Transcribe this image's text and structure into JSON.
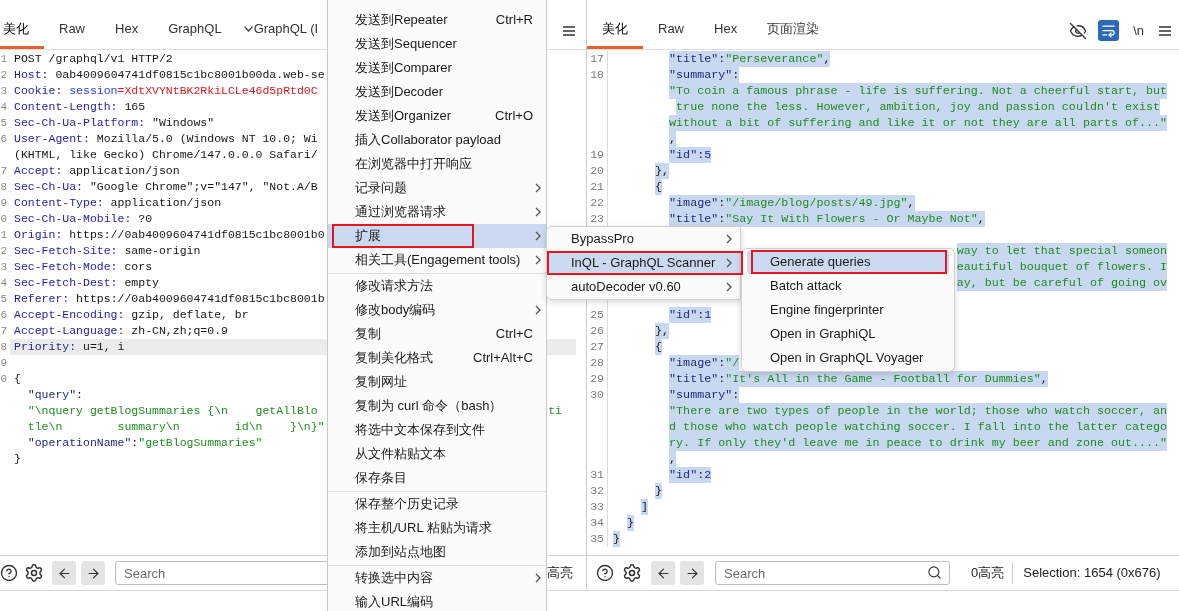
{
  "request_panel": {
    "tabs": [
      {
        "label": "美化",
        "selected": true,
        "kind": "text"
      },
      {
        "label": "Raw",
        "selected": false,
        "kind": "text"
      },
      {
        "label": "Hex",
        "selected": false,
        "kind": "text"
      },
      {
        "label": "GraphQL",
        "selected": false,
        "kind": "text"
      },
      {
        "label": "GraphQL (I",
        "selected": false,
        "kind": "dropdown"
      }
    ],
    "lines": [
      {
        "number": "1",
        "current": false,
        "segments": [
          {
            "text": "POST /graphql/v1 HTTP/2",
            "kind": "plain"
          }
        ]
      },
      {
        "number": "2",
        "current": false,
        "segments": [
          {
            "text": "Host:",
            "kind": "header"
          },
          {
            "text": " 0ab4009604741df0815c1bc8001b00da.web-se",
            "kind": "plain"
          }
        ]
      },
      {
        "number": "3",
        "current": false,
        "segments": [
          {
            "text": "Cookie:",
            "kind": "header"
          },
          {
            "text": " session",
            "kind": "cookie-name"
          },
          {
            "text": "=XdtXVYNtBK2RkiLCLe46d5pRtd0C",
            "kind": "cookie-value"
          }
        ]
      },
      {
        "number": "4",
        "current": false,
        "segments": [
          {
            "text": "Content-Length:",
            "kind": "header"
          },
          {
            "text": " 165",
            "kind": "plain"
          }
        ]
      },
      {
        "number": "5",
        "current": false,
        "segments": [
          {
            "text": "Sec-Ch-Ua-Platform:",
            "kind": "header"
          },
          {
            "text": " \"Windows\"",
            "kind": "plain"
          }
        ]
      },
      {
        "number": "6",
        "current": false,
        "segments": [
          {
            "text": "User-Agent:",
            "kind": "header"
          },
          {
            "text": " Mozilla/5.0 (Windows NT 10.0; Wi",
            "kind": "plain"
          }
        ]
      },
      {
        "current": false,
        "segments": [
          {
            "text": "(KHTML, like Gecko) Chrome/147.0.0.0 Safari/",
            "kind": "plain"
          }
        ]
      },
      {
        "number": "7",
        "current": false,
        "segments": [
          {
            "text": "Accept:",
            "kind": "header"
          },
          {
            "text": " application/json",
            "kind": "plain"
          }
        ]
      },
      {
        "number": "8",
        "current": false,
        "segments": [
          {
            "text": "Sec-Ch-Ua:",
            "kind": "header"
          },
          {
            "text": " \"Google Chrome\";v=\"147\", \"Not.A/B",
            "kind": "plain"
          }
        ]
      },
      {
        "number": "9",
        "current": false,
        "segments": [
          {
            "text": "Content-Type:",
            "kind": "header"
          },
          {
            "text": " application/json",
            "kind": "plain"
          }
        ]
      },
      {
        "number": "0",
        "current": false,
        "segments": [
          {
            "text": "Sec-Ch-Ua-Mobile:",
            "kind": "header"
          },
          {
            "text": " ?0",
            "kind": "plain"
          }
        ]
      },
      {
        "number": "1",
        "current": false,
        "segments": [
          {
            "text": "Origin:",
            "kind": "header"
          },
          {
            "text": " https://0ab4009604741df0815c1bc8001b0",
            "kind": "plain"
          }
        ]
      },
      {
        "number": "2",
        "current": false,
        "segments": [
          {
            "text": "Sec-Fetch-Site:",
            "kind": "header"
          },
          {
            "text": " same-origin",
            "kind": "plain"
          }
        ]
      },
      {
        "number": "3",
        "current": false,
        "segments": [
          {
            "text": "Sec-Fetch-Mode:",
            "kind": "header"
          },
          {
            "text": " cors",
            "kind": "plain"
          }
        ]
      },
      {
        "number": "4",
        "current": false,
        "segments": [
          {
            "text": "Sec-Fetch-Dest:",
            "kind": "header"
          },
          {
            "text": " empty",
            "kind": "plain"
          }
        ]
      },
      {
        "number": "5",
        "current": false,
        "segments": [
          {
            "text": "Referer:",
            "kind": "header"
          },
          {
            "text": " https://0ab4009604741df0815c1bc8001b",
            "kind": "plain"
          }
        ]
      },
      {
        "number": "6",
        "current": false,
        "segments": [
          {
            "text": "Accept-Encoding:",
            "kind": "header"
          },
          {
            "text": " gzip, deflate, br",
            "kind": "plain"
          }
        ]
      },
      {
        "number": "7",
        "current": false,
        "segments": [
          {
            "text": "Accept-Language:",
            "kind": "header"
          },
          {
            "text": " zh-CN,zh;q=0.9",
            "kind": "plain"
          }
        ]
      },
      {
        "number": "8",
        "current": true,
        "segments": [
          {
            "text": "Priority:",
            "kind": "header"
          },
          {
            "text": " u=1, i",
            "kind": "plain"
          }
        ]
      },
      {
        "number": "9",
        "current": false
      },
      {
        "number": "0",
        "current": false,
        "segments": [
          {
            "text": "{",
            "kind": "plain"
          }
        ]
      },
      {
        "current": false,
        "segments": [
          {
            "text": "  \"query\"",
            "kind": "key"
          },
          {
            "text": ":",
            "kind": "punct"
          }
        ]
      },
      {
        "current": false,
        "segments": [
          {
            "text": "  \"\\nquery getBlogSummaries {\\n    getAllBlo",
            "kind": "string"
          }
        ],
        "tail": [
          {
            "text": "ti",
            "kind": "string"
          }
        ]
      },
      {
        "current": false,
        "segments": [
          {
            "text": "  tle\\n        summary\\n        id\\n    }\\n}\"",
            "kind": "string"
          }
        ]
      },
      {
        "current": false,
        "segments": [
          {
            "text": "  \"operationName\"",
            "kind": "key"
          },
          {
            "text": ":",
            "kind": "punct"
          },
          {
            "text": "\"getBlogSummaries\"",
            "kind": "string"
          }
        ]
      },
      {
        "current": false,
        "segments": [
          {
            "text": "}",
            "kind": "plain"
          }
        ]
      }
    ],
    "search": {
      "placeholder": "Search"
    },
    "highlight_count": "高亮"
  },
  "response_panel": {
    "tabs": [
      {
        "label": "美化",
        "selected": true,
        "kind": "text"
      },
      {
        "label": "Raw",
        "selected": false,
        "kind": "text"
      },
      {
        "label": "Hex",
        "selected": false,
        "kind": "text"
      },
      {
        "label": "页面渲染",
        "selected": false,
        "kind": "text"
      }
    ],
    "word_wrap_on": true,
    "newline_toggle": "\\n",
    "lines": [
      {
        "kind": "line",
        "number": "17",
        "selected": true,
        "segments": [
          {
            "text": "        \"title\"",
            "kind": "key"
          },
          {
            "text": ":",
            "kind": "punct"
          },
          {
            "text": "\"Perseverance\"",
            "kind": "string"
          },
          {
            "text": ",",
            "kind": "punct"
          }
        ]
      },
      {
        "kind": "line",
        "number": "18",
        "selected": true,
        "segments": [
          {
            "text": "        \"summary\"",
            "kind": "key"
          },
          {
            "text": ":",
            "kind": "punct"
          }
        ]
      },
      {
        "kind": "line",
        "selected": true,
        "segments": [
          {
            "text": "        \"To coin a famous phrase - life is suffering. Not a cheerful start, but",
            "kind": "string"
          }
        ]
      },
      {
        "kind": "line",
        "selected": true,
        "segments": [
          {
            "text": "         true none the less. However, ambition, joy and passion couldn't exist",
            "kind": "string"
          }
        ]
      },
      {
        "kind": "line",
        "selected": true,
        "segments": [
          {
            "text": "        without a bit of suffering and like it or not they are all parts of...\"",
            "kind": "string"
          }
        ]
      },
      {
        "kind": "line",
        "selected": true,
        "segments": [
          {
            "text": "        ,",
            "kind": "punct"
          }
        ]
      },
      {
        "kind": "line",
        "number": "19",
        "selected": true,
        "segments": [
          {
            "text": "        \"id\"",
            "kind": "key"
          },
          {
            "text": ":",
            "kind": "punct"
          },
          {
            "text": "5",
            "kind": "number"
          }
        ]
      },
      {
        "kind": "line",
        "number": "20",
        "selected": true,
        "segments": [
          {
            "text": "      },",
            "kind": "punct"
          }
        ]
      },
      {
        "kind": "line",
        "number": "21",
        "selected": true,
        "segments": [
          {
            "text": "      {",
            "kind": "punct"
          }
        ]
      },
      {
        "kind": "line",
        "number": "22",
        "selected": true,
        "segments": [
          {
            "text": "        \"image\"",
            "kind": "key"
          },
          {
            "text": ":",
            "kind": "punct"
          },
          {
            "text": "\"/image/blog/posts/49.jpg\"",
            "kind": "string"
          },
          {
            "text": ",",
            "kind": "punct"
          }
        ]
      },
      {
        "kind": "line",
        "number": "23",
        "selected": true,
        "segments": [
          {
            "text": "        \"title\"",
            "kind": "key"
          },
          {
            "text": ":",
            "kind": "punct"
          },
          {
            "text": "\"Say It With Flowers - Or Maybe Not\"",
            "kind": "string"
          },
          {
            "text": ",",
            "kind": "punct"
          }
        ]
      },
      {
        "kind": "covered"
      },
      {
        "kind": "end",
        "selected": true,
        "segments": [
          {
            "text": "way to let that special someon",
            "kind": "string"
          }
        ]
      },
      {
        "kind": "end",
        "selected": true,
        "segments": [
          {
            "text": "eautiful bouquet of flowers. I",
            "kind": "string"
          }
        ]
      },
      {
        "kind": "end",
        "selected": true,
        "segments": [
          {
            "text": "ay, but be careful of going ov",
            "kind": "string"
          }
        ]
      },
      {
        "kind": "covered"
      },
      {
        "kind": "line",
        "number": "25",
        "selected": true,
        "segments": [
          {
            "text": "        \"id\"",
            "kind": "key"
          },
          {
            "text": ":",
            "kind": "punct"
          },
          {
            "text": "1",
            "kind": "number"
          }
        ]
      },
      {
        "kind": "line",
        "number": "26",
        "selected": true,
        "segments": [
          {
            "text": "      },",
            "kind": "punct"
          }
        ]
      },
      {
        "kind": "line",
        "number": "27",
        "selected": true,
        "segments": [
          {
            "text": "      {",
            "kind": "punct"
          }
        ]
      },
      {
        "kind": "line",
        "number": "28",
        "selected": true,
        "segments": [
          {
            "text": "        \"image\"",
            "kind": "key"
          },
          {
            "text": ":",
            "kind": "punct"
          },
          {
            "text": "\"/",
            "kind": "string"
          }
        ]
      },
      {
        "kind": "line",
        "number": "29",
        "selected": true,
        "segments": [
          {
            "text": "        \"title\"",
            "kind": "key"
          },
          {
            "text": ":",
            "kind": "punct"
          },
          {
            "text": "\"It's All in the Game - Football for Dummies\"",
            "kind": "string"
          },
          {
            "text": ",",
            "kind": "punct"
          }
        ]
      },
      {
        "kind": "line",
        "number": "30",
        "selected": true,
        "segments": [
          {
            "text": "        \"summary\"",
            "kind": "key"
          },
          {
            "text": ":",
            "kind": "punct"
          }
        ]
      },
      {
        "kind": "line",
        "selected": true,
        "segments": [
          {
            "text": "        \"There are two types of people in the world; those who watch soccer, an",
            "kind": "string"
          }
        ]
      },
      {
        "kind": "line",
        "selected": true,
        "segments": [
          {
            "text": "        d those who watch people watching soccer. I fall into the latter catego",
            "kind": "string"
          }
        ]
      },
      {
        "kind": "line",
        "selected": true,
        "segments": [
          {
            "text": "        ry. If only they'd leave me in peace to drink my beer and zone out....\"",
            "kind": "string"
          }
        ]
      },
      {
        "kind": "line",
        "selected": true,
        "segments": [
          {
            "text": "        ,",
            "kind": "punct"
          }
        ]
      },
      {
        "kind": "line",
        "number": "31",
        "selected": true,
        "segments": [
          {
            "text": "        \"id\"",
            "kind": "key"
          },
          {
            "text": ":",
            "kind": "punct"
          },
          {
            "text": "2",
            "kind": "number"
          }
        ]
      },
      {
        "kind": "line",
        "number": "32",
        "selected": true,
        "segments": [
          {
            "text": "      }",
            "kind": "punct"
          }
        ]
      },
      {
        "kind": "line",
        "number": "33",
        "selected": true,
        "segments": [
          {
            "text": "    ]",
            "kind": "punct"
          }
        ]
      },
      {
        "kind": "line",
        "number": "34",
        "selected": true,
        "segments": [
          {
            "text": "  }",
            "kind": "punct"
          }
        ]
      },
      {
        "kind": "line",
        "number": "35",
        "selected": true,
        "segments": [
          {
            "text": "}",
            "kind": "punct"
          }
        ]
      }
    ],
    "search": {
      "placeholder": "Search"
    },
    "highlight_count": "0高亮",
    "selection_info": "Selection: 1654 (0x676)"
  },
  "context_menu": {
    "items": [
      {
        "kind": "item",
        "label": "发送到Repeater",
        "shortcut": "Ctrl+R",
        "submenu": false,
        "highlighted": false,
        "annotated": false
      },
      {
        "kind": "item",
        "label": "发送到Sequencer",
        "submenu": false,
        "highlighted": false,
        "annotated": false
      },
      {
        "kind": "item",
        "label": "发送到Comparer",
        "submenu": false,
        "highlighted": false,
        "annotated": false
      },
      {
        "kind": "item",
        "label": "发送到Decoder",
        "submenu": false,
        "highlighted": false,
        "annotated": false
      },
      {
        "kind": "item",
        "label": "发送到Organizer",
        "shortcut": "Ctrl+O",
        "submenu": false,
        "highlighted": false,
        "annotated": false
      },
      {
        "kind": "item",
        "label": "插入Collaborator payload",
        "submenu": false,
        "highlighted": false,
        "annotated": false
      },
      {
        "kind": "item",
        "label": "在浏览器中打开响应",
        "submenu": false,
        "highlighted": false,
        "annotated": false
      },
      {
        "kind": "item",
        "label": "记录问题",
        "submenu": true,
        "highlighted": false,
        "annotated": false
      },
      {
        "kind": "item",
        "label": "通过浏览器请求",
        "submenu": true,
        "highlighted": false,
        "annotated": false
      },
      {
        "kind": "item",
        "label": "扩展",
        "submenu": true,
        "highlighted": true,
        "annotated": true
      },
      {
        "kind": "item",
        "label": "相关工具(Engagement tools)",
        "submenu": true,
        "highlighted": false,
        "annotated": false
      },
      {
        "kind": "separator"
      },
      {
        "kind": "item",
        "label": "修改请求方法",
        "submenu": false,
        "highlighted": false,
        "annotated": false
      },
      {
        "kind": "item",
        "label": "修改body编码",
        "submenu": true,
        "highlighted": false,
        "annotated": false
      },
      {
        "kind": "item",
        "label": "复制",
        "shortcut": "Ctrl+C",
        "submenu": false,
        "highlighted": false,
        "annotated": false
      },
      {
        "kind": "item",
        "label": "复制美化格式",
        "shortcut": "Ctrl+Alt+C",
        "submenu": false,
        "highlighted": false,
        "annotated": false
      },
      {
        "kind": "item",
        "label": "复制网址",
        "submenu": false,
        "highlighted": false,
        "annotated": false
      },
      {
        "kind": "item",
        "label": "复制为 curl 命令（bash）",
        "submenu": false,
        "highlighted": false,
        "annotated": false
      },
      {
        "kind": "item",
        "label": "将选中文本保存到文件",
        "submenu": false,
        "highlighted": false,
        "annotated": false
      },
      {
        "kind": "item",
        "label": "从文件粘贴文本",
        "submenu": false,
        "highlighted": false,
        "annotated": false
      },
      {
        "kind": "item",
        "label": "保存条目",
        "submenu": false,
        "highlighted": false,
        "annotated": false
      },
      {
        "kind": "separator"
      },
      {
        "kind": "item",
        "label": "保存整个历史记录",
        "submenu": false,
        "highlighted": false,
        "annotated": false
      },
      {
        "kind": "item",
        "label": "将主机/URL 粘贴为请求",
        "submenu": false,
        "highlighted": false,
        "annotated": false
      },
      {
        "kind": "item",
        "label": "添加到站点地图",
        "submenu": false,
        "highlighted": false,
        "annotated": false
      },
      {
        "kind": "separator"
      },
      {
        "kind": "item",
        "label": "转换选中内容",
        "submenu": true,
        "highlighted": false,
        "annotated": false
      },
      {
        "kind": "item",
        "label": "输入URL编码",
        "submenu": false,
        "highlighted": false,
        "annotated": false
      }
    ]
  },
  "extensions_submenu": {
    "items": [
      {
        "kind": "item",
        "label": "BypassPro",
        "submenu": true,
        "highlighted": false,
        "annotated": false
      },
      {
        "kind": "item",
        "label": "InQL - GraphQL Scanner",
        "submenu": true,
        "highlighted": true,
        "annotated": true
      },
      {
        "kind": "item",
        "label": "autoDecoder v0.60",
        "submenu": true,
        "highlighted": false,
        "annotated": false
      }
    ]
  },
  "inql_submenu": {
    "items": [
      {
        "kind": "item",
        "label": "Generate queries",
        "highlighted": true,
        "annotated": true
      },
      {
        "kind": "item",
        "label": "Batch attack",
        "highlighted": false,
        "annotated": false
      },
      {
        "kind": "item",
        "label": "Engine fingerprinter",
        "highlighted": false,
        "annotated": false
      },
      {
        "kind": "item",
        "label": "Open in GraphiQL",
        "highlighted": false,
        "annotated": false
      },
      {
        "kind": "item",
        "label": "Open in GraphQL Voyager",
        "highlighted": false,
        "annotated": false
      }
    ]
  }
}
